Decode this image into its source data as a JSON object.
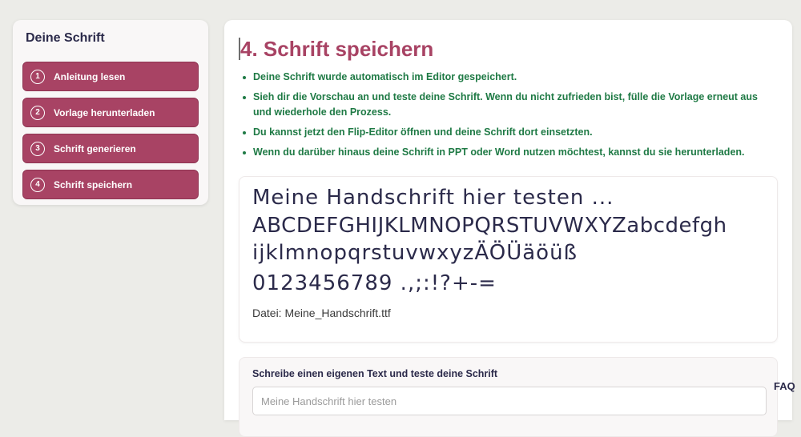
{
  "sidebar": {
    "title": "Deine Schrift",
    "steps": [
      {
        "num": "1",
        "label": "Anleitung lesen"
      },
      {
        "num": "2",
        "label": "Vorlage herunterladen"
      },
      {
        "num": "3",
        "label": "Schrift generieren"
      },
      {
        "num": "4",
        "label": "Schrift speichern"
      }
    ]
  },
  "main": {
    "title": "4. Schrift speichern",
    "instructions": [
      "Deine Schrift wurde automatisch im Editor gespeichert.",
      "Sieh dir die Vorschau an und teste deine Schrift. Wenn du nicht zufrieden bist, fülle die Vorlage erneut aus und wiederhole den Prozess.",
      "Du kannst jetzt den Flip-Editor öffnen und deine Schrift dort einsetzten.",
      "Wenn du darüber hinaus deine Schrift in PPT oder Word nutzen möchtest, kannst du sie herunterladen."
    ],
    "preview": {
      "lines": [
        "Meine Handschrift hier testen ...",
        "ABCDEFGHIJKLMNOPQRSTUVWXYZabcdefgh",
        "ijklmnopqrstuvwxyzÄÖÜäöüß",
        "0123456789 .,;:!?+-="
      ],
      "file_label": "Datei: Meine_Handschrift.ttf"
    },
    "own_text": {
      "label": "Schreibe einen eigenen Text und teste deine Schrift",
      "placeholder": "Meine Handschrift hier testen"
    }
  },
  "faq_label": "FAQ",
  "colors": {
    "accent": "#a84364",
    "instruction_text": "#1f7a45",
    "dark_text": "#2b2a4a",
    "background": "#ecece8"
  }
}
